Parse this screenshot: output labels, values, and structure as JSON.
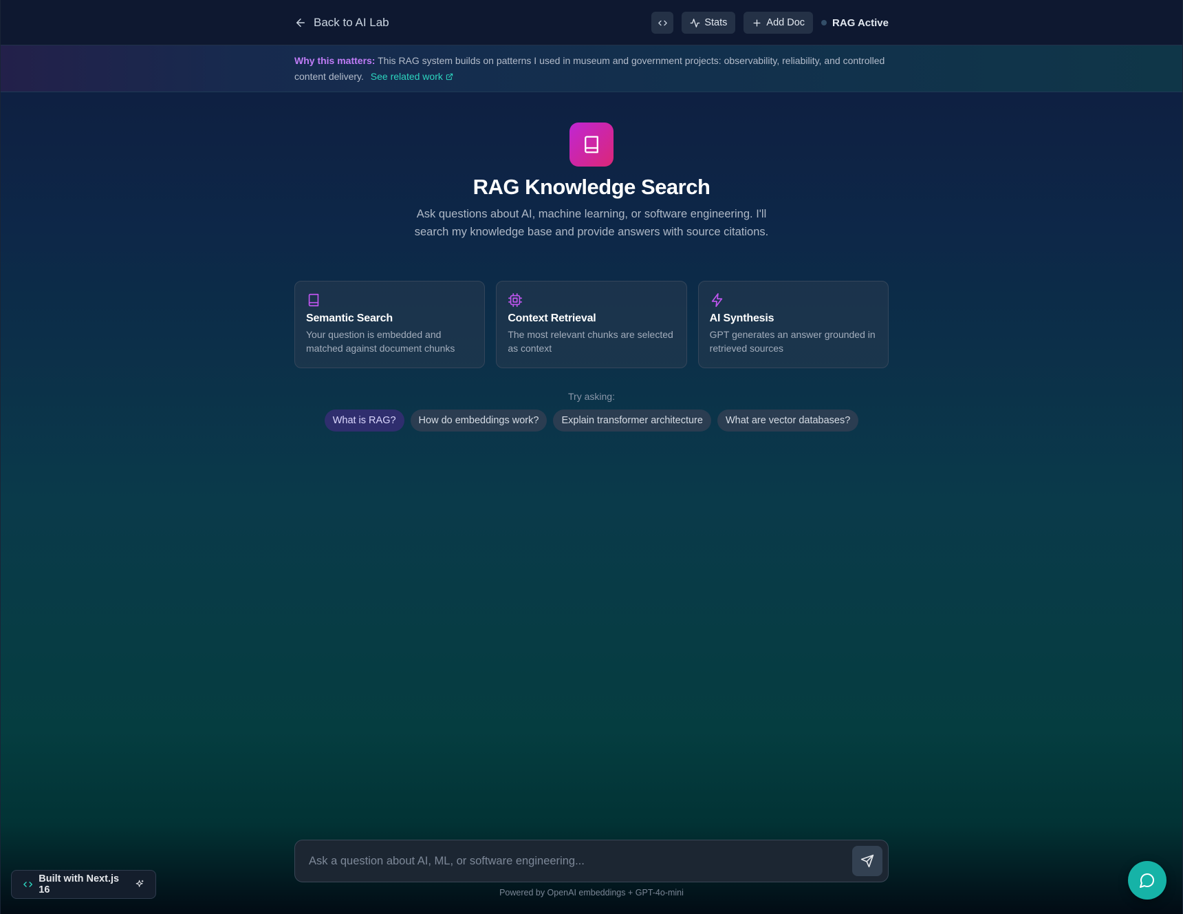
{
  "header": {
    "back_label": "Back to AI Lab",
    "stats_label": "Stats",
    "add_doc_label": "Add Doc",
    "status_label": "RAG Active"
  },
  "banner": {
    "strong": "Why this matters:",
    "text": "This RAG system builds on patterns I used in museum and government projects: observability, reliability, and controlled content delivery.",
    "link": "See related work"
  },
  "hero": {
    "title": "RAG Knowledge Search",
    "subtitle": "Ask questions about AI, machine learning, or software engineering. I'll search my knowledge base and provide answers with source citations."
  },
  "features": [
    {
      "icon": "book-icon",
      "title": "Semantic Search",
      "desc": "Your question is embedded and matched against document chunks"
    },
    {
      "icon": "cpu-icon",
      "title": "Context Retrieval",
      "desc": "The most relevant chunks are selected as context"
    },
    {
      "icon": "zap-icon",
      "title": "AI Synthesis",
      "desc": "GPT generates an answer grounded in retrieved sources"
    }
  ],
  "try_asking": {
    "label": "Try asking:",
    "chips": [
      "What is RAG?",
      "How do embeddings work?",
      "Explain transformer architecture",
      "What are vector databases?"
    ]
  },
  "input": {
    "placeholder": "Ask a question about AI, ML, or software engineering...",
    "value": ""
  },
  "footer": {
    "powered": "Powered by OpenAI embeddings + GPT-4o-mini",
    "built_badge": "Built with Next.js 16"
  },
  "colors": {
    "accent_purple": "#c07cf7",
    "accent_teal": "#2dd4bf",
    "fab": "#16b3a7",
    "hero_gradient_start": "#c026d3",
    "hero_gradient_end": "#db2777"
  }
}
